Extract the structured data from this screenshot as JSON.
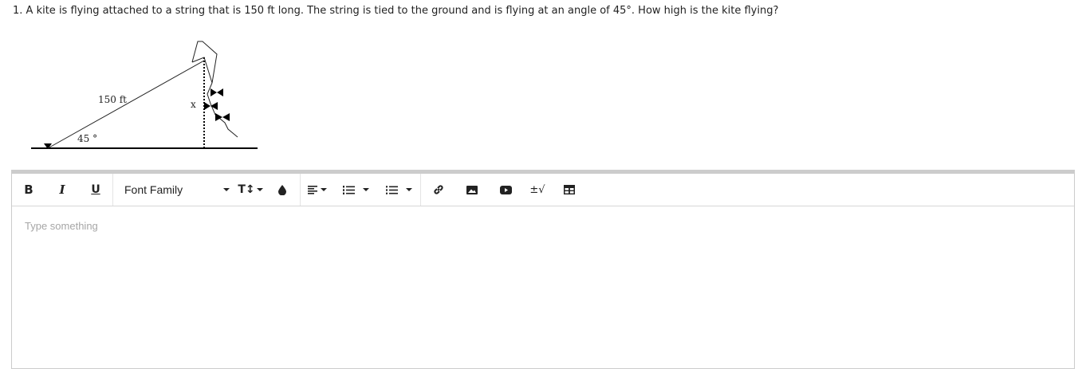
{
  "question": {
    "number": "1.",
    "text": "A kite is flying attached to a string that is 150 ft long. The string is tied to the ground and is flying at an angle of 45°. How high is the kite flying?"
  },
  "diagram": {
    "hyp_label": "150 ft",
    "angle_label": "45 °",
    "height_label": "x"
  },
  "toolbar": {
    "bold": "B",
    "italic": "I",
    "underline": "U",
    "font_family": "Font Family",
    "font_size": "T↕",
    "math": "±√"
  },
  "editor": {
    "placeholder": "Type something"
  }
}
